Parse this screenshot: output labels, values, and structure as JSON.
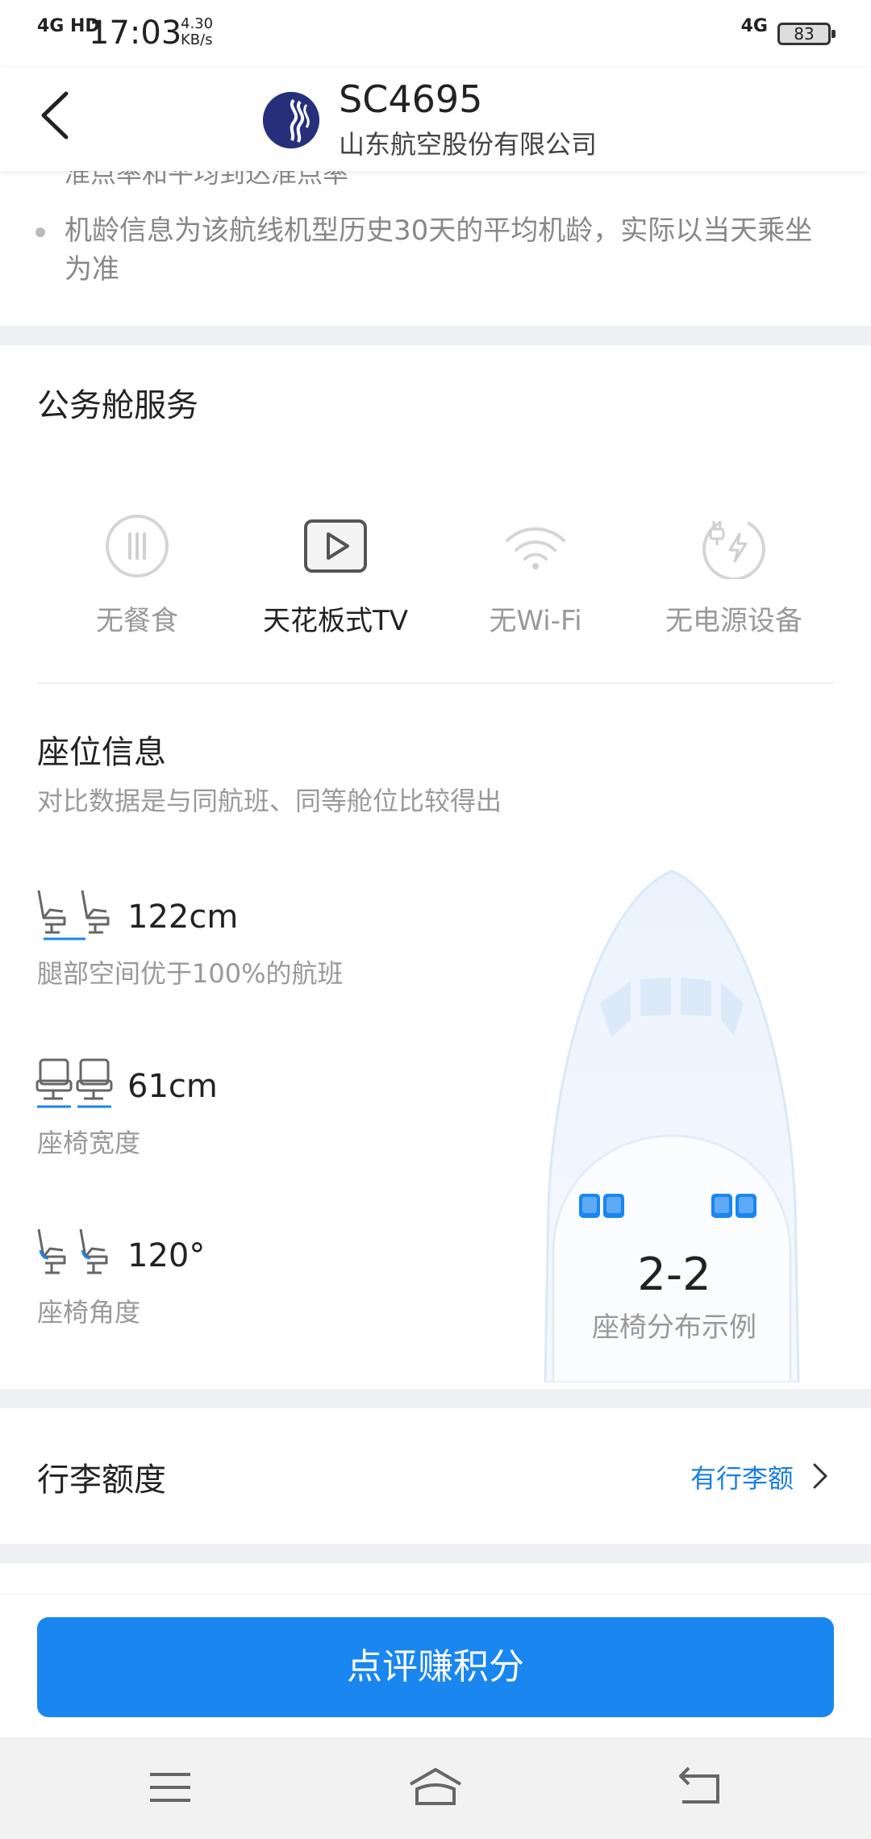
{
  "status_bar": {
    "network": "4G HD",
    "time": "17:03",
    "speed_value": "4.30",
    "speed_unit": "KB/s",
    "network_right": "4G",
    "battery": "83"
  },
  "header": {
    "flight_no": "SC4695",
    "airline": "山东航空股份有限公司"
  },
  "notes": {
    "partial_line": "准点率和平均到达准点率",
    "aircraft_age_note": "机龄信息为该航线机型历史30天的平均机龄，实际以当天乘坐为准"
  },
  "services": {
    "title": "公务舱服务",
    "items": [
      {
        "label": "无餐食",
        "icon": "meal-icon",
        "available": false
      },
      {
        "label": "天花板式TV",
        "icon": "tv-play-icon",
        "available": true
      },
      {
        "label": "无Wi-Fi",
        "icon": "wifi-icon",
        "available": false
      },
      {
        "label": "无电源设备",
        "icon": "power-plug-icon",
        "available": false
      }
    ]
  },
  "seat_info": {
    "title": "座位信息",
    "subtitle": "对比数据是与同航班、同等舱位比较得出",
    "metrics": [
      {
        "value": "122cm",
        "desc": "腿部空间优于100%的航班",
        "icon": "legroom-icon"
      },
      {
        "value": "61cm",
        "desc": "座椅宽度",
        "icon": "seat-width-icon"
      },
      {
        "value": "120°",
        "desc": "座椅角度",
        "icon": "seat-angle-icon"
      }
    ],
    "layout": {
      "value": "2-2",
      "caption": "座椅分布示例"
    }
  },
  "baggage": {
    "title": "行李额度",
    "link": "有行李额"
  },
  "cta": {
    "label": "点评赚积分"
  },
  "colors": {
    "accent": "#1a86f0",
    "link": "#1a7fe0",
    "gap": "#eef0f3"
  }
}
